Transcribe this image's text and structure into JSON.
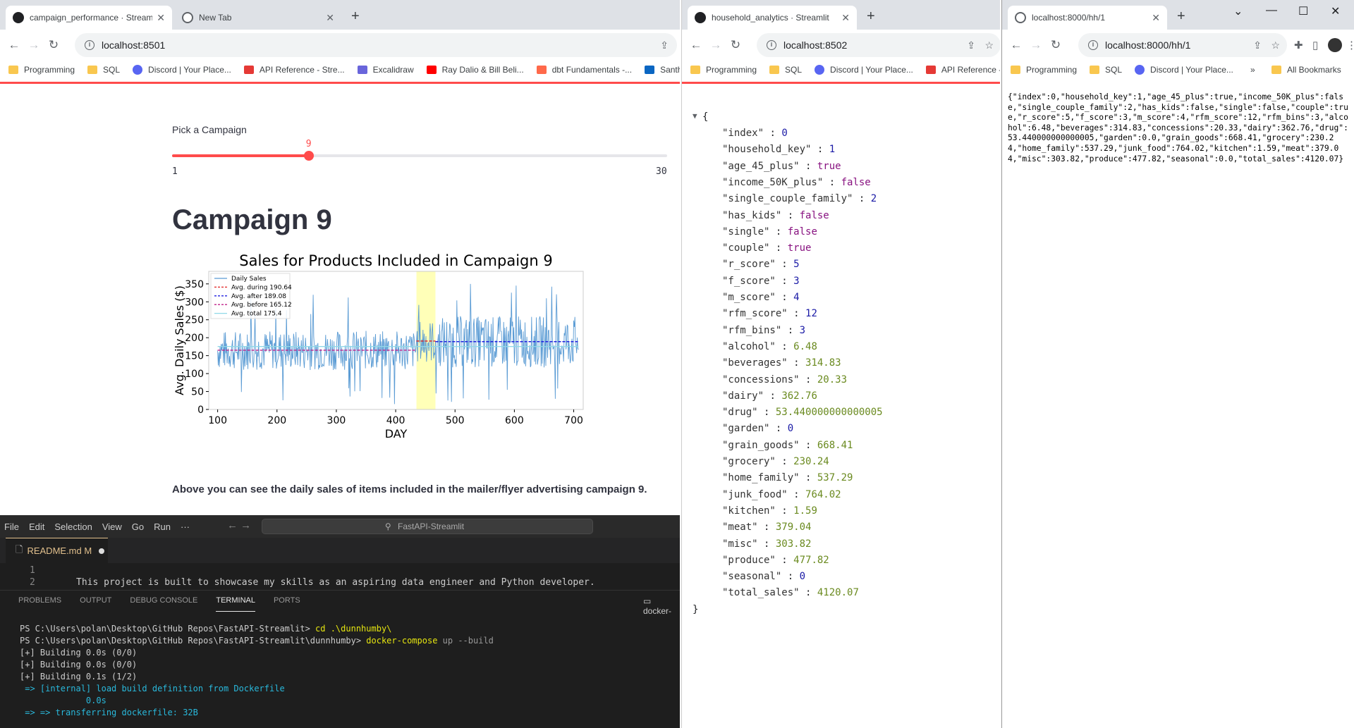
{
  "window1": {
    "tabs": [
      {
        "label": "campaign_performance · Streamlit"
      },
      {
        "label": "New Tab"
      }
    ],
    "url": "localhost:8501",
    "bookmarks": [
      "Programming",
      "SQL",
      "Discord | Your Place...",
      "API Reference - Stre...",
      "Excalidraw",
      "Ray Dalio & Bill Beli...",
      "dbt Fundamentals -...",
      "Santhia"
    ],
    "slider": {
      "label": "Pick a Campaign",
      "value": "9",
      "min": "1",
      "max": "30",
      "fraction": 0.276
    },
    "title": "Campaign 9",
    "caption": "Above you can see the daily sales of items included in the mailer/flyer advertising campaign 9."
  },
  "chart_data": {
    "type": "line",
    "title": "Sales for Products Included in Campaign 9",
    "xlabel": "DAY",
    "ylabel": "Avg. Daily Sales ($)",
    "xlim": [
      85,
      716
    ],
    "ylim": [
      0,
      385
    ],
    "xticks": [
      "100",
      "200",
      "300",
      "400",
      "500",
      "600",
      "700"
    ],
    "yticks": [
      "0",
      "50",
      "100",
      "150",
      "200",
      "250",
      "300",
      "350"
    ],
    "highlight_span": [
      435,
      467
    ],
    "legend_position": "top-left",
    "series": [
      {
        "name": "Daily Sales",
        "color": "#5a9bd4"
      },
      {
        "name": "Avg. during 190.64",
        "color": "#e02020",
        "style": "dashed",
        "y": 190.64,
        "x_range": [
          435,
          467
        ]
      },
      {
        "name": "Avg. after 189.08",
        "color": "#2020e0",
        "style": "dashed",
        "y": 189.08,
        "x_range": [
          467,
          708
        ]
      },
      {
        "name": "Avg. before 165.12",
        "color": "#c0208a",
        "style": "dashed",
        "y": 165.12,
        "x_range": [
          100,
          435
        ]
      },
      {
        "name": "Avg. total 175.4",
        "color": "#90d8e8",
        "style": "solid",
        "y": 175.4,
        "x_range": [
          100,
          708
        ]
      }
    ]
  },
  "vscode": {
    "menu": [
      "File",
      "Edit",
      "Selection",
      "View",
      "Go",
      "Run",
      "···"
    ],
    "search": "FastAPI-Streamlit",
    "tab": "README.md",
    "tab_badge": "M",
    "line_numbers": [
      "1",
      "2"
    ],
    "code_line": "This project is built to showcase my skills as an aspiring data engineer and Python developer.",
    "panel_tabs": [
      "PROBLEMS",
      "OUTPUT",
      "DEBUG CONSOLE",
      "TERMINAL",
      "PORTS"
    ],
    "panel_right": "docker-",
    "terminal": {
      "l1_prompt": "PS C:\\Users\\polan\\Desktop\\GitHub Repos\\FastAPI-Streamlit> ",
      "l1_cmd": "cd .\\dunnhumby\\",
      "l2_prompt": "PS C:\\Users\\polan\\Desktop\\GitHub Repos\\FastAPI-Streamlit\\dunnhumby> ",
      "l2_cmd": "docker-compose",
      "l2_args": " up --build",
      "l3": "[+] Building 0.0s (0/0)",
      "l4": "[+] Building 0.0s (0/0)",
      "l5": "[+] Building 0.1s (1/2)",
      "l6": " => [internal] load build definition from Dockerfile",
      "l7": "             0.0s",
      "l8": " => => transferring dockerfile: 32B"
    }
  },
  "window2": {
    "tab": "household_analytics · Streamlit",
    "url": "localhost:8502",
    "bookmarks": [
      "Programming",
      "SQL",
      "Discord | Your Place...",
      "API Reference - S"
    ],
    "json_open": "{",
    "json_close": "}",
    "fields": [
      {
        "k": "\"index\"",
        "v": "0",
        "t": "num"
      },
      {
        "k": "\"household_key\"",
        "v": "1",
        "t": "num"
      },
      {
        "k": "\"age_45_plus\"",
        "v": "true",
        "t": "bool"
      },
      {
        "k": "\"income_50K_plus\"",
        "v": "false",
        "t": "bool"
      },
      {
        "k": "\"single_couple_family\"",
        "v": "2",
        "t": "num"
      },
      {
        "k": "\"has_kids\"",
        "v": "false",
        "t": "bool"
      },
      {
        "k": "\"single\"",
        "v": "false",
        "t": "bool"
      },
      {
        "k": "\"couple\"",
        "v": "true",
        "t": "bool"
      },
      {
        "k": "\"r_score\"",
        "v": "5",
        "t": "num"
      },
      {
        "k": "\"f_score\"",
        "v": "3",
        "t": "num"
      },
      {
        "k": "\"m_score\"",
        "v": "4",
        "t": "num"
      },
      {
        "k": "\"rfm_score\"",
        "v": "12",
        "t": "num"
      },
      {
        "k": "\"rfm_bins\"",
        "v": "3",
        "t": "num"
      },
      {
        "k": "\"alcohol\"",
        "v": "6.48",
        "t": "dec"
      },
      {
        "k": "\"beverages\"",
        "v": "314.83",
        "t": "dec"
      },
      {
        "k": "\"concessions\"",
        "v": "20.33",
        "t": "dec"
      },
      {
        "k": "\"dairy\"",
        "v": "362.76",
        "t": "dec"
      },
      {
        "k": "\"drug\"",
        "v": "53.440000000000005",
        "t": "dec"
      },
      {
        "k": "\"garden\"",
        "v": "0",
        "t": "num"
      },
      {
        "k": "\"grain_goods\"",
        "v": "668.41",
        "t": "dec"
      },
      {
        "k": "\"grocery\"",
        "v": "230.24",
        "t": "dec"
      },
      {
        "k": "\"home_family\"",
        "v": "537.29",
        "t": "dec"
      },
      {
        "k": "\"junk_food\"",
        "v": "764.02",
        "t": "dec"
      },
      {
        "k": "\"kitchen\"",
        "v": "1.59",
        "t": "dec"
      },
      {
        "k": "\"meat\"",
        "v": "379.04",
        "t": "dec"
      },
      {
        "k": "\"misc\"",
        "v": "303.82",
        "t": "dec"
      },
      {
        "k": "\"produce\"",
        "v": "477.82",
        "t": "dec"
      },
      {
        "k": "\"seasonal\"",
        "v": "0",
        "t": "num"
      },
      {
        "k": "\"total_sales\"",
        "v": "4120.07",
        "t": "dec"
      }
    ]
  },
  "window3": {
    "tab": "localhost:8000/hh/1",
    "url": "localhost:8000/hh/1",
    "bookmarks": [
      "Programming",
      "SQL",
      "Discord | Your Place..."
    ],
    "more_bookmarks": "»",
    "all_bookmarks": "All Bookmarks",
    "raw": "{\"index\":0,\"household_key\":1,\"age_45_plus\":true,\"income_50K_plus\":false,\"single_couple_family\":2,\"has_kids\":false,\"single\":false,\"couple\":true,\"r_score\":5,\"f_score\":3,\"m_score\":4,\"rfm_score\":12,\"rfm_bins\":3,\"alcohol\":6.48,\"beverages\":314.83,\"concessions\":20.33,\"dairy\":362.76,\"drug\":53.440000000000005,\"garden\":0.0,\"grain_goods\":668.41,\"grocery\":230.24,\"home_family\":537.29,\"junk_food\":764.02,\"kitchen\":1.59,\"meat\":379.04,\"misc\":303.82,\"produce\":477.82,\"seasonal\":0.0,\"total_sales\":4120.07}"
  }
}
